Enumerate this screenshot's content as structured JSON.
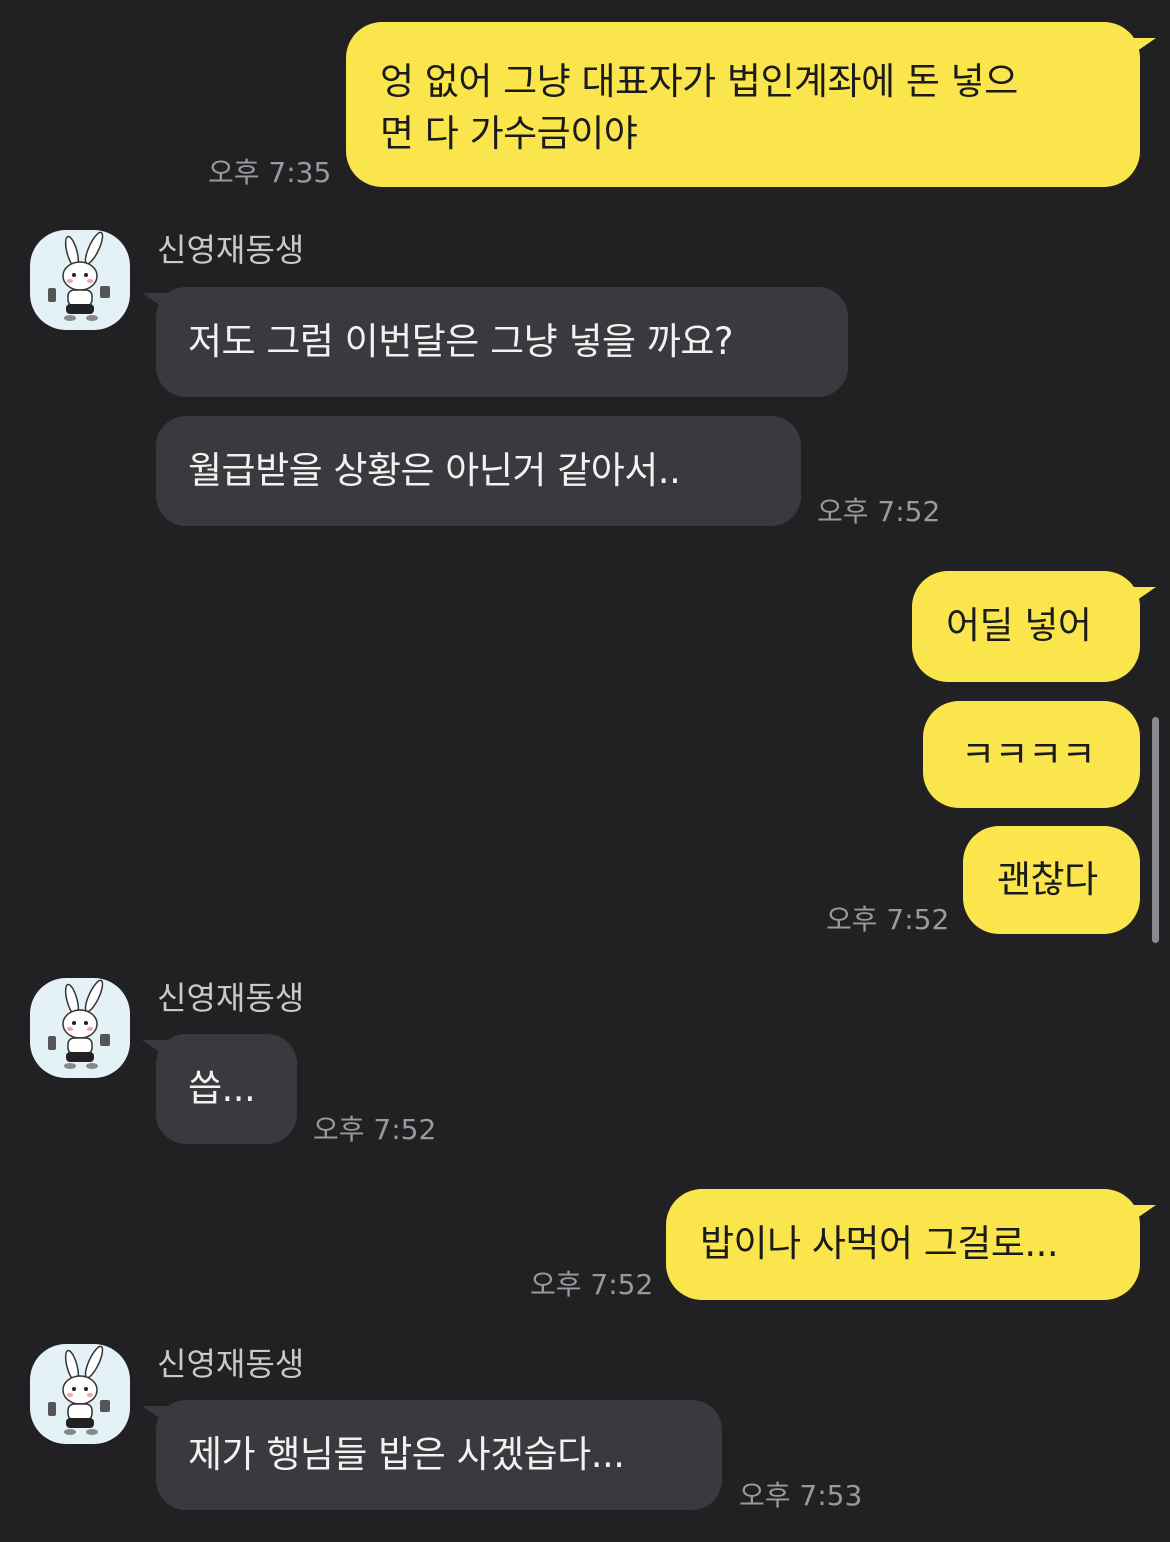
{
  "theme": {
    "mine_bubble": "#fae64c",
    "their_bubble": "#3a3a3e",
    "background": "#212124"
  },
  "messages": [
    {
      "from": "me",
      "lines": [
        "엉 없어 그냥 대표자가 법인계좌에 돈 넣으",
        "면 다 가수금이야"
      ],
      "time": "오후 7:35"
    },
    {
      "from": "them",
      "sender": "신영재동생",
      "texts": [
        "저도 그럼 이번달은 그냥 넣을 까요?",
        "월급받을 상황은 아닌거 같아서.."
      ],
      "time": "오후 7:52"
    },
    {
      "from": "me",
      "texts": [
        "어딜 넣어",
        "ㅋㅋㅋㅋ",
        "괜찮다"
      ],
      "time": "오후 7:52"
    },
    {
      "from": "them",
      "sender": "신영재동생",
      "texts": [
        "씁..."
      ],
      "time": "오후 7:52"
    },
    {
      "from": "me",
      "texts": [
        "밥이나 사먹어 그걸로..."
      ],
      "time": "오후 7:52"
    },
    {
      "from": "them",
      "sender": "신영재동생",
      "texts": [
        "제가 행님들 밥은 사겠습다..."
      ],
      "time": "오후 7:53"
    }
  ],
  "icons": {
    "avatar": "rabbit-avatar-icon"
  }
}
